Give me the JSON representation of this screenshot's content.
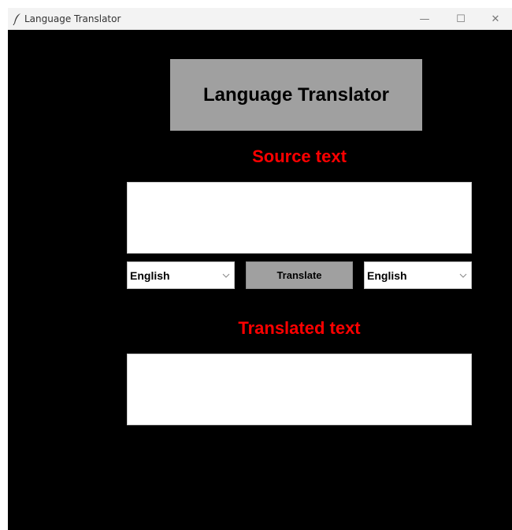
{
  "window": {
    "title": "Language Translator",
    "minimize_glyph": "—",
    "maximize_glyph": "☐",
    "close_glyph": "✕",
    "icon": "feather-icon"
  },
  "header": {
    "title": "Language Translator"
  },
  "source": {
    "label": "Source text",
    "value": "",
    "language": "English"
  },
  "actions": {
    "translate_label": "Translate"
  },
  "target": {
    "label": "Translated text",
    "value": "",
    "language": "English"
  },
  "colors": {
    "background": "#000000",
    "accent_label": "#ff0000",
    "button_gray": "#a0a0a0"
  }
}
